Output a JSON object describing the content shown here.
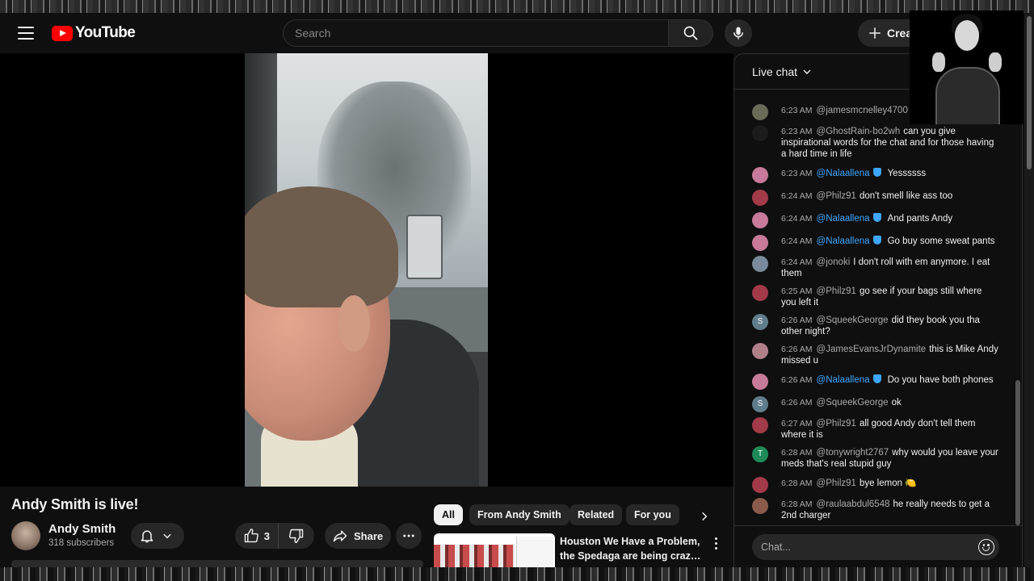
{
  "header": {
    "logo_text": "YouTube",
    "search_placeholder": "Search",
    "create_label": "Create"
  },
  "video": {
    "title": "Andy Smith is live!",
    "channel_name": "Andy Smith",
    "subscribers": "318 subscribers",
    "like_count": "3",
    "share_label": "Share"
  },
  "chips": [
    "All",
    "From Andy Smith",
    "Related",
    "For you"
  ],
  "related": {
    "title_line1": "Houston We Have a Problem,",
    "title_line2": "the Spedaga are being crazy ..."
  },
  "chat": {
    "header_title": "Live chat",
    "input_placeholder": "Chat...",
    "messages": [
      {
        "time": "6:23 AM",
        "author": "@jamesmcnelley4700",
        "text": "",
        "mod": false,
        "avatar_color": "#6b6b5a"
      },
      {
        "time": "6:23 AM",
        "author": "@GhostRain-bo2wh",
        "text": "can you give inspirational words for the chat and for those having a hard time in life",
        "mod": false,
        "avatar_color": "#1c1c1c"
      },
      {
        "time": "6:23 AM",
        "author": "@Nalaallena",
        "text": "Yessssss",
        "mod": true,
        "avatar_color": "#c77a9a"
      },
      {
        "time": "6:24 AM",
        "author": "@Philz91",
        "text": "don't smell like ass too",
        "mod": false,
        "avatar_color": "#a23a4a"
      },
      {
        "time": "6:24 AM",
        "author": "@Nalaallena",
        "text": "And pants Andy",
        "mod": true,
        "avatar_color": "#c77a9a"
      },
      {
        "time": "6:24 AM",
        "author": "@Nalaallena",
        "text": "Go buy some sweat pants",
        "mod": true,
        "avatar_color": "#c77a9a"
      },
      {
        "time": "6:24 AM",
        "author": "@jonoki",
        "text": "I don't roll with em anymore. I eat them",
        "mod": false,
        "avatar_color": "#7a8a9a"
      },
      {
        "time": "6:25 AM",
        "author": "@Philz91",
        "text": "go see if your bags still where you left it",
        "mod": false,
        "avatar_color": "#a23a4a"
      },
      {
        "time": "6:26 AM",
        "author": "@SqueekGeorge",
        "text": "did they book you tha other night?",
        "mod": false,
        "avatar_color": "#607d8b",
        "initial": "S"
      },
      {
        "time": "6:26 AM",
        "author": "@JamesEvansJrDynamite",
        "text": "this is Mike Andy missed u",
        "mod": false,
        "avatar_color": "#b0808a"
      },
      {
        "time": "6:26 AM",
        "author": "@Nalaallena",
        "text": "Do you have both phones",
        "mod": true,
        "avatar_color": "#c77a9a"
      },
      {
        "time": "6:26 AM",
        "author": "@SqueekGeorge",
        "text": "ok",
        "mod": false,
        "avatar_color": "#607d8b",
        "initial": "S"
      },
      {
        "time": "6:27 AM",
        "author": "@Philz91",
        "text": "all good Andy don't tell them where it is",
        "mod": false,
        "avatar_color": "#a23a4a"
      },
      {
        "time": "6:28 AM",
        "author": "@tonywright2767",
        "text": "why would you leave your meds that's real stupid guy",
        "mod": false,
        "avatar_color": "#1e8a5a",
        "initial": "T"
      },
      {
        "time": "6:28 AM",
        "author": "@Philz91",
        "text": "bye lemon 🍋",
        "mod": false,
        "avatar_color": "#a23a4a"
      },
      {
        "time": "6:28 AM",
        "author": "@raulaabdul6548",
        "text": "he really needs to get a 2nd charger",
        "mod": false,
        "avatar_color": "#8a5a4a"
      }
    ]
  }
}
